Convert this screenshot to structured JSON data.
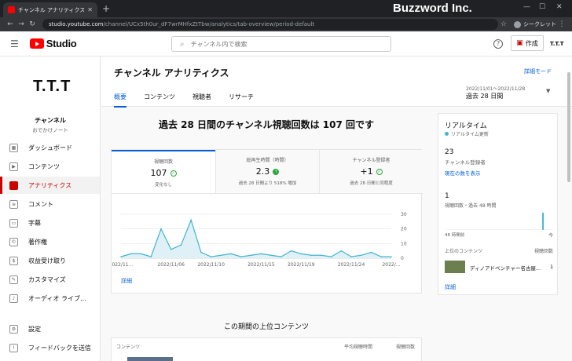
{
  "browser": {
    "tab_title": "チャンネル アナリティクス - YouTube S",
    "url_host": "studio.youtube.com",
    "url_path": "/channel/UCx5th0ur_dF7wrMHfxZtTbw/analytics/tab-overview/period-default",
    "incognito_label": "シークレット",
    "watermark": "Buzzword Inc."
  },
  "header": {
    "logo_text": "Studio",
    "search_placeholder": "チャンネル内で検索",
    "create_label": "作成",
    "account": "T.T.T"
  },
  "sidebar": {
    "channel_avatar": "T.T.T",
    "channel_name": "チャンネル",
    "channel_sub": "おでかけノート",
    "items": [
      {
        "label": "ダッシュボード",
        "icon": "dashboard-icon"
      },
      {
        "label": "コンテンツ",
        "icon": "content-icon"
      },
      {
        "label": "アナリティクス",
        "icon": "analytics-icon"
      },
      {
        "label": "コメント",
        "icon": "comment-icon"
      },
      {
        "label": "字幕",
        "icon": "subtitles-icon"
      },
      {
        "label": "著作権",
        "icon": "copyright-icon"
      },
      {
        "label": "収益受け取り",
        "icon": "monetization-icon"
      },
      {
        "label": "カスタマイズ",
        "icon": "customize-icon"
      },
      {
        "label": "オーディオ ライブ...",
        "icon": "audio-library-icon"
      },
      {
        "label": "設定",
        "icon": "settings-icon"
      },
      {
        "label": "フィードバックを送信",
        "icon": "feedback-icon"
      }
    ]
  },
  "main": {
    "title": "チャンネル アナリティクス",
    "advanced_mode": "詳細モード",
    "tabs": [
      "概要",
      "コンテンツ",
      "視聴者",
      "リサーチ"
    ],
    "date_range": "2022/11/01～2022/11/28",
    "date_period": "過去 28 日間",
    "headline": "過去 28 日間のチャンネル視聴回数は 107 回です",
    "metrics": [
      {
        "label": "視聴回数",
        "value": "107",
        "note": "変化なし"
      },
      {
        "label": "総再生時間（時間）",
        "value": "2.3",
        "note": "過去 28 日間より 518% 増加"
      },
      {
        "label": "チャンネル登録者",
        "value": "+1",
        "note": "過去 28 日間と同程度"
      }
    ],
    "more_link": "詳細",
    "top_content_title": "この期間の上位コンテンツ",
    "top_content_headers": [
      "コンテンツ",
      "平均視聴時間",
      "視聴回数"
    ]
  },
  "chart_data": {
    "type": "area",
    "x": [
      "11/01",
      "11/02",
      "11/03",
      "11/04",
      "11/05",
      "11/06",
      "11/07",
      "11/08",
      "11/09",
      "11/10",
      "11/11",
      "11/12",
      "11/13",
      "11/14",
      "11/15",
      "11/16",
      "11/17",
      "11/18",
      "11/19",
      "11/20",
      "11/21",
      "11/22",
      "11/23",
      "11/24",
      "11/25",
      "11/26",
      "11/27",
      "11/28"
    ],
    "values": [
      1,
      3,
      3,
      1,
      20,
      6,
      9,
      26,
      4,
      1,
      2,
      3,
      1,
      2,
      3,
      2,
      1,
      5,
      3,
      2,
      2,
      1,
      5,
      1,
      2,
      4,
      1,
      1
    ],
    "tick_labels": [
      "2022/11...",
      "2022/11/06",
      "2022/11/10",
      "2022/11/15",
      "2022/11/19",
      "2022/11/24",
      "2022/..."
    ],
    "tick_index": [
      0,
      5,
      9,
      14,
      18,
      23,
      27
    ],
    "ylim": [
      0,
      30
    ],
    "yticks": [
      "0",
      "10",
      "20",
      "30"
    ],
    "grid": true,
    "colors": {
      "line": "#41b4d2",
      "fill": "#dff1f7"
    }
  },
  "realtime": {
    "title": "リアルタイム",
    "live_label": "リアルタイム更新",
    "subscribers": "23",
    "subscribers_label": "チャンネル登録者",
    "show_current": "現在の数を表示",
    "views": "1",
    "views_label": "視聴回数・過去 48 時間",
    "bars": [
      0,
      0,
      0,
      0,
      0,
      0,
      0,
      0,
      0,
      0,
      0,
      0,
      0,
      0,
      0,
      0,
      0,
      0,
      0,
      0,
      0,
      0,
      0,
      0,
      0,
      0,
      0,
      0,
      0,
      0,
      0,
      0,
      0,
      0,
      0,
      0,
      0,
      0,
      0,
      0,
      0,
      0,
      0,
      1,
      0,
      0,
      0,
      0
    ],
    "axis_left": "48 時間前",
    "axis_right": "今",
    "top_content_label": "上位のコンテンツ",
    "views_header": "視聴回数",
    "top_video": "ディノアドベンチャー名古屋...",
    "top_video_views": "1",
    "detail_link": "詳細"
  }
}
